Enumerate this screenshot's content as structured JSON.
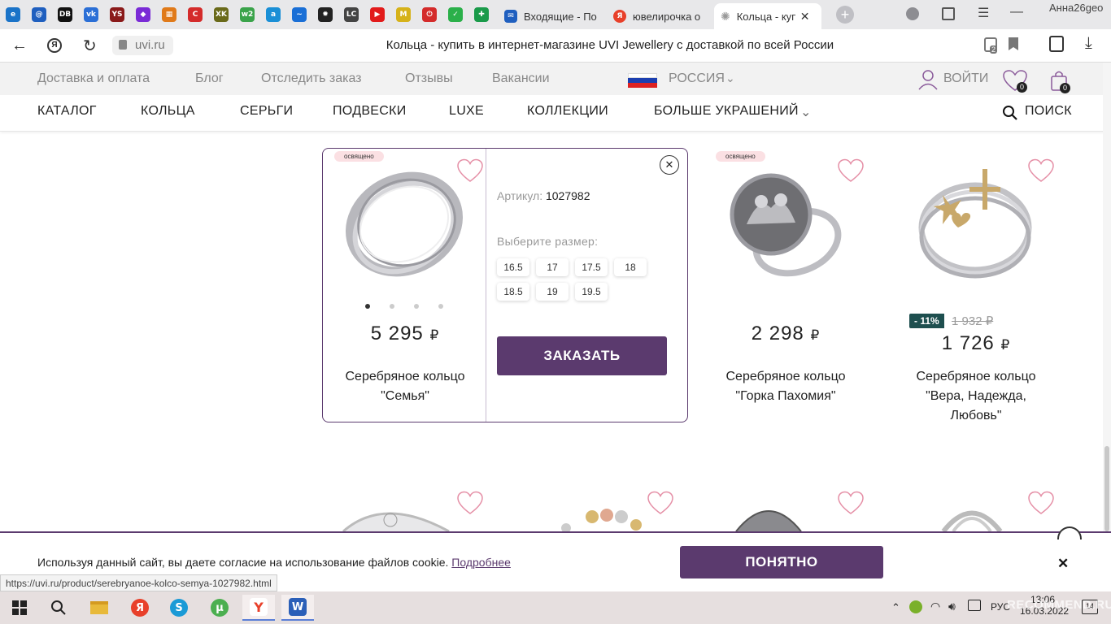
{
  "browser": {
    "fav_tabs": [
      {
        "icon": "edge-icon",
        "glyph": "e",
        "color": "#1a73c8"
      },
      {
        "icon": "mail-at-icon",
        "glyph": "@",
        "color": "#1f5fbf"
      },
      {
        "icon": "db-icon",
        "glyph": "DB",
        "color": "#111111"
      },
      {
        "icon": "vk-icon",
        "glyph": "vk",
        "color": "#2b6fd6"
      },
      {
        "icon": "ys-icon",
        "glyph": "YS",
        "color": "#8a1a1a"
      },
      {
        "icon": "purple-icon",
        "glyph": "◆",
        "color": "#7a2bd6"
      },
      {
        "icon": "orange-grid-icon",
        "glyph": "▦",
        "color": "#e07a1a"
      },
      {
        "icon": "red-circle-icon",
        "glyph": "C",
        "color": "#d42b2b"
      },
      {
        "icon": "xk-icon",
        "glyph": "XK",
        "color": "#6a6a1a"
      },
      {
        "icon": "w2-icon",
        "glyph": "w2",
        "color": "#3aa34a"
      },
      {
        "icon": "a-icon",
        "glyph": "a",
        "color": "#1a8fd6"
      },
      {
        "icon": "feather-icon",
        "glyph": "~",
        "color": "#1a6fd6"
      },
      {
        "icon": "gear-star-icon",
        "glyph": "✹",
        "color": "#222222"
      },
      {
        "icon": "lc-icon",
        "glyph": "LC",
        "color": "#444444"
      },
      {
        "icon": "youtube-icon",
        "glyph": "▶",
        "color": "#e21b1b"
      },
      {
        "icon": "yellow-m-icon",
        "glyph": "M",
        "color": "#d6b21a"
      },
      {
        "icon": "power-icon",
        "glyph": "⏻",
        "color": "#d42b2b"
      },
      {
        "icon": "check-icon",
        "glyph": "✓",
        "color": "#2bb04a"
      },
      {
        "icon": "cross-icon",
        "glyph": "✚",
        "color": "#1a9a4a"
      }
    ],
    "tabs": [
      {
        "title": "Входящие - По"
      },
      {
        "title": "ювелирочка о"
      },
      {
        "title": "Кольца - куп"
      }
    ],
    "profile": "Анна26geo",
    "url": "uvi.ru",
    "page_title": "Кольца - купить в интернет-магазине UVI Jewellery с доставкой по всей России",
    "reader_badge": "2",
    "status_url": "https://uvi.ru/product/serebryanoe-kolco-semya-1027982.html"
  },
  "topnav": {
    "links": [
      "Доставка и оплата",
      "Блог",
      "Отследить заказ",
      "Отзывы",
      "Вакансии"
    ],
    "country": "РОССИЯ",
    "login": "ВОЙТИ",
    "fav_count": "0",
    "cart_count": "0"
  },
  "mainnav": {
    "items": [
      "КАТАЛОГ",
      "КОЛЬЦА",
      "СЕРЬГИ",
      "ПОДВЕСКИ",
      "LUXE",
      "КОЛЛЕКЦИИ",
      "БОЛЬШЕ УКРАШЕНИЙ"
    ],
    "search": "ПОИСК"
  },
  "products": [
    {
      "badge": "освящено",
      "price": "5 295",
      "currency": "₽",
      "title_1": "Серебряное кольцо",
      "title_2": "\"Семья\""
    },
    {
      "badge": "освящено",
      "price": "2 298",
      "currency": "₽",
      "title_1": "Серебряное кольцо",
      "title_2": "\"Горка Пахомия\""
    },
    {
      "discount": "- 11%",
      "old_price": "1 932 ₽",
      "price": "1 726",
      "currency": "₽",
      "title_1": "Серебряное кольцо",
      "title_2": "\"Вера, Надежда,",
      "title_3": "Любовь\""
    }
  ],
  "popup": {
    "article_label": "Артикул:",
    "article_value": "1027982",
    "size_label": "Выберите размер:",
    "sizes": [
      "16.5",
      "17",
      "17.5",
      "18",
      "18.5",
      "19",
      "19.5"
    ],
    "order_button": "ЗАКАЗАТЬ"
  },
  "cookie": {
    "text": "Используя данный сайт, вы даете согласие на использование файлов cookie.",
    "link": "Подробнее",
    "accept": "ПОНЯТНО"
  },
  "taskbar": {
    "lang": "РУС",
    "time": "13:06",
    "date": "16.03.2022",
    "notif_count": "14",
    "watermark": "RECOMMEND.RU"
  },
  "colors": {
    "brand": "#5b3a6e",
    "badge": "#fbe0e3",
    "heart": "#e58fa6",
    "discount": "#1e4f4f"
  }
}
